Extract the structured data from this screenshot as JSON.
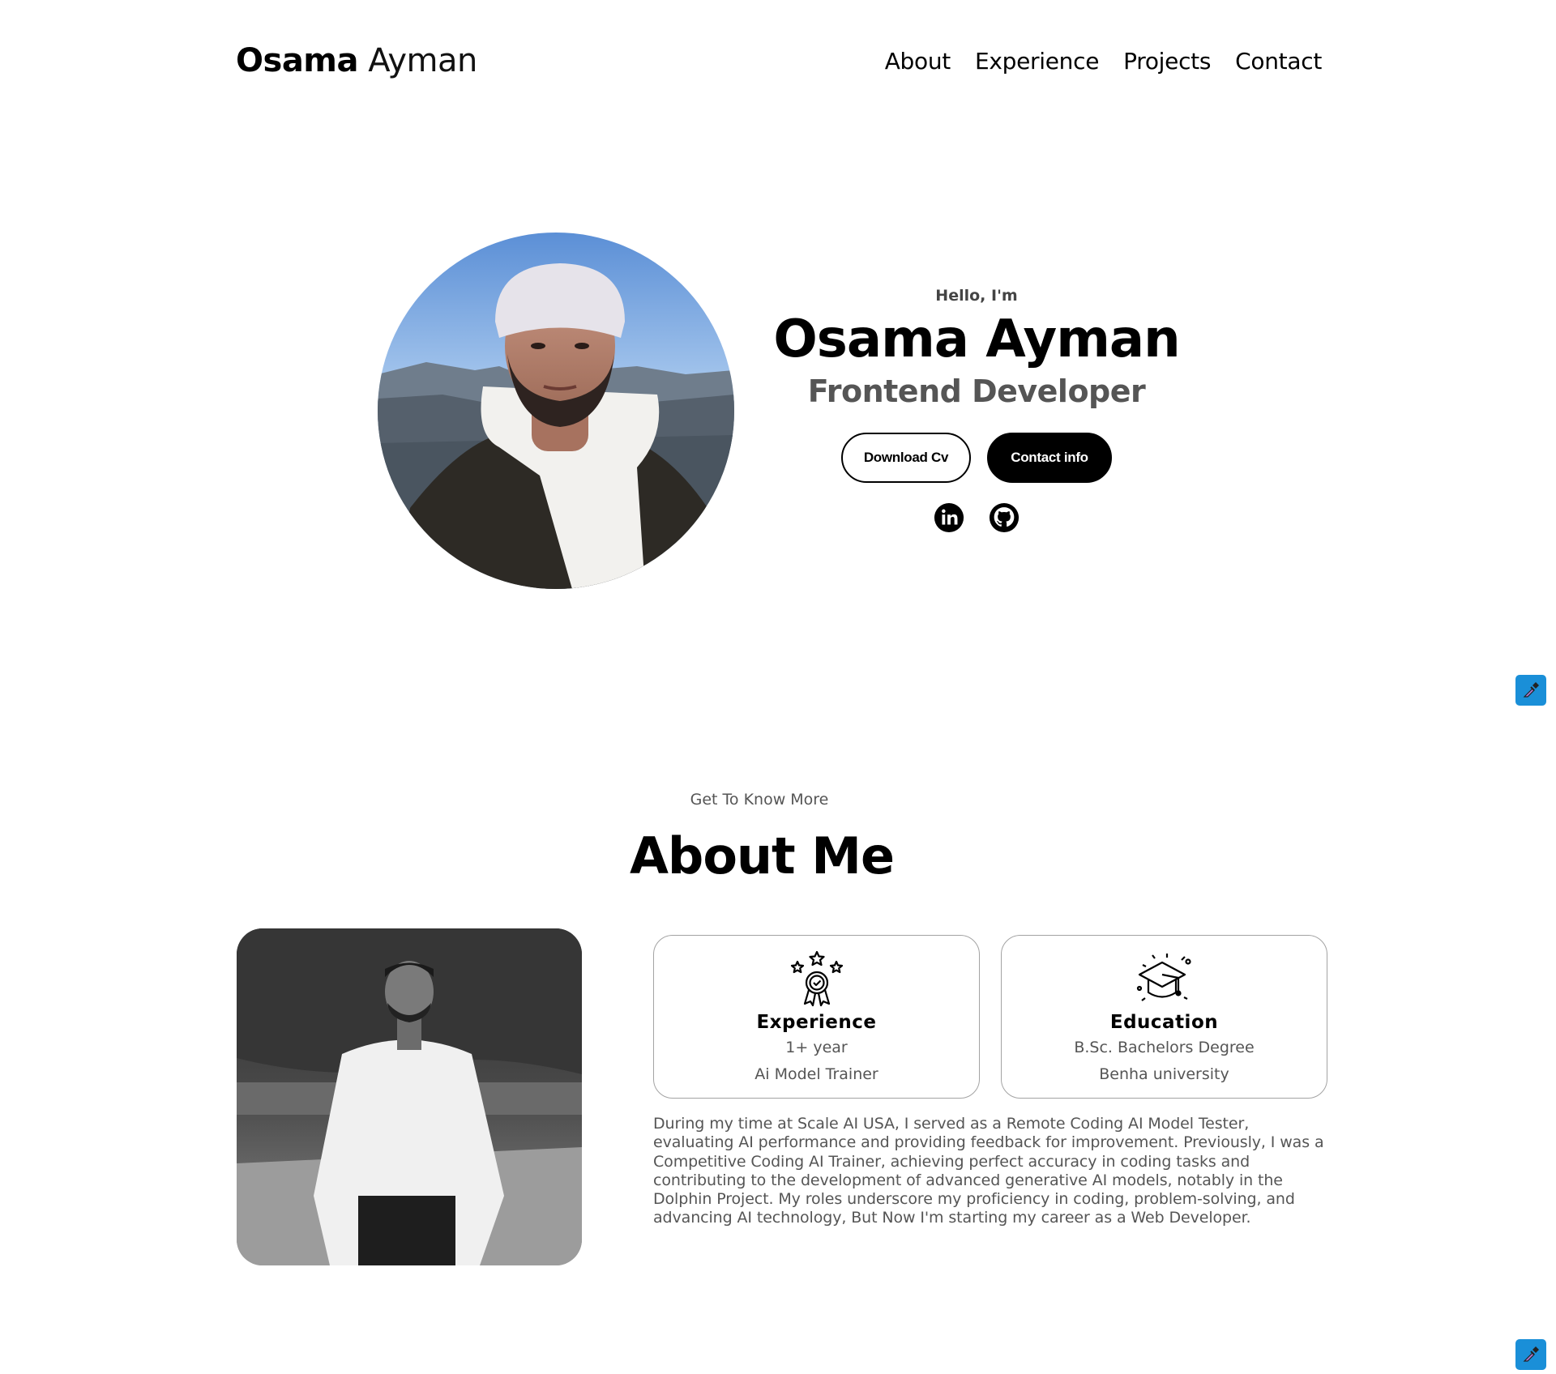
{
  "nav": {
    "logo_first": "Osama",
    "logo_last": "Ayman",
    "links": [
      "About",
      "Experience",
      "Projects",
      "Contact"
    ]
  },
  "hero": {
    "greeting": "Hello, I'm",
    "name": "Osama Ayman",
    "role": "Frontend Developer",
    "download_cv_label": "Download Cv",
    "contact_info_label": "Contact info",
    "social_icons": [
      "linkedin-icon",
      "github-icon"
    ]
  },
  "about": {
    "subtitle": "Get To Know More",
    "title": "About Me",
    "experience_card": {
      "title": "Experience",
      "line1": "1+ year",
      "line2": "Ai Model Trainer",
      "icon": "award-stars-icon"
    },
    "education_card": {
      "title": "Education",
      "line1": "B.Sc. Bachelors Degree",
      "line2": "Benha university",
      "icon": "graduation-cap-icon"
    },
    "paragraph": "During my time at Scale AI USA, I served as a Remote Coding AI Model Tester, evaluating AI performance and providing feedback for improvement. Previously, I was a Competitive Coding AI Trainer, achieving perfect accuracy in coding tasks and contributing to the development of advanced generative AI models, notably in the Dolphin Project. My roles underscore my proficiency in coding, problem-solving, and advancing AI technology, But Now I'm starting my career as a Web Developer."
  },
  "floating_tool": {
    "icon": "eyedropper-icon",
    "color": "#1a8fd8"
  }
}
